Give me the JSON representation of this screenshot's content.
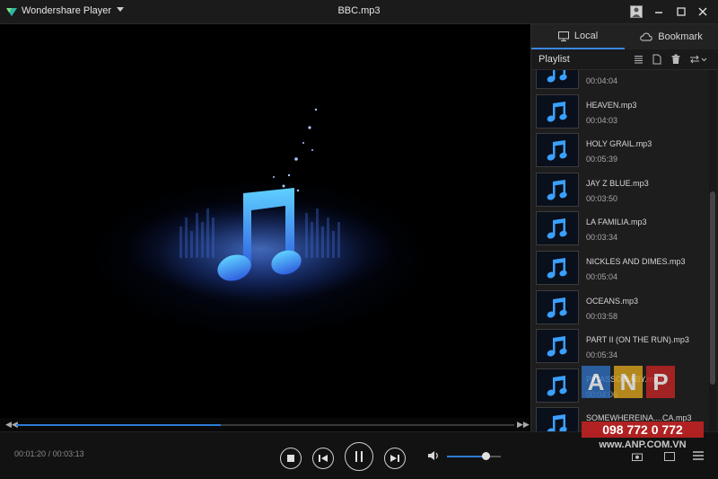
{
  "app": {
    "name": "Wondershare Player",
    "title": "BBC.mp3"
  },
  "player": {
    "current_time": "00:01:20",
    "total_time": "00:03:13",
    "progress": 0.41,
    "volume": 0.72
  },
  "panel": {
    "tabs": [
      {
        "label": "Local",
        "icon": "monitor-icon"
      },
      {
        "label": "Bookmark",
        "icon": "cloud-icon"
      }
    ],
    "playlist_label": "Playlist",
    "items": [
      {
        "name": "",
        "duration": "00:04:04"
      },
      {
        "name": "HEAVEN.mp3",
        "duration": "00:04:03"
      },
      {
        "name": "HOLY GRAIL.mp3",
        "duration": "00:05:39"
      },
      {
        "name": "JAY Z BLUE.mp3",
        "duration": "00:03:50"
      },
      {
        "name": "LA FAMILIA.mp3",
        "duration": "00:03:34"
      },
      {
        "name": "NICKLES AND DIMES.mp3",
        "duration": "00:05:04"
      },
      {
        "name": "OCEANS.mp3",
        "duration": "00:03:58"
      },
      {
        "name": "PART II (ON THE RUN).mp3",
        "duration": "00:05:34"
      },
      {
        "name": "PICASSO BABY.mp3",
        "duration": "00:04:06"
      },
      {
        "name": "SOMEWHEREINA....CA.mp3",
        "duration": ""
      }
    ]
  },
  "watermark": {
    "letters": [
      "A",
      "N",
      "P"
    ],
    "colors": [
      "#2e6fbf",
      "#d9a21c",
      "#c42525"
    ],
    "phone": "098 772 0 772",
    "site": "www.ANP.COM.VN"
  },
  "colors": {
    "accent": "#2e7bd6",
    "note": "#3aa0ff"
  }
}
